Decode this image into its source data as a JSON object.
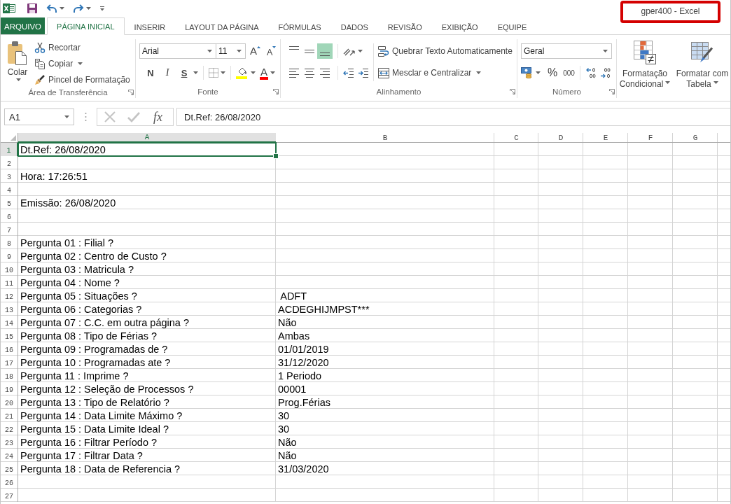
{
  "title": "gper400 - Excel",
  "title_highlight": true,
  "tabs": [
    {
      "label": "ARQUIVO",
      "kind": "file",
      "selected": false
    },
    {
      "label": "PÁGINA INICIAL",
      "kind": "tab",
      "selected": true
    },
    {
      "label": "INSERIR",
      "kind": "tab",
      "selected": false
    },
    {
      "label": "LAYOUT DA PÁGINA",
      "kind": "tab",
      "selected": false
    },
    {
      "label": "FÓRMULAS",
      "kind": "tab",
      "selected": false
    },
    {
      "label": "DADOS",
      "kind": "tab",
      "selected": false
    },
    {
      "label": "REVISÃO",
      "kind": "tab",
      "selected": false
    },
    {
      "label": "EXIBIÇÃO",
      "kind": "tab",
      "selected": false
    },
    {
      "label": "EQUIPE",
      "kind": "tab",
      "selected": false
    }
  ],
  "ribbon": {
    "clipboard": {
      "label": "Área de Transferência",
      "paste": "Colar",
      "items": [
        {
          "kind": "cut",
          "label": "Recortar",
          "dropdown": false
        },
        {
          "kind": "copy",
          "label": "Copiar",
          "dropdown": true
        },
        {
          "kind": "painter",
          "label": "Pincel de Formatação",
          "dropdown": false
        }
      ]
    },
    "font": {
      "label": "Fonte",
      "font_name": "Arial",
      "font_size": "11",
      "size_buttons": [
        {
          "kind": "grow",
          "label": "A"
        },
        {
          "kind": "shrink",
          "label": "A"
        }
      ],
      "styles": [
        {
          "kind": "bold",
          "label": "N",
          "dropdown": false
        },
        {
          "kind": "italic",
          "label": "I",
          "dropdown": false
        },
        {
          "kind": "underline",
          "label": "S",
          "dropdown": true
        }
      ],
      "font_color_label": "A"
    },
    "alignment": {
      "label": "Alinhamento",
      "vertical": [
        {
          "kind": "top",
          "selected": false
        },
        {
          "kind": "middle",
          "selected": false
        },
        {
          "kind": "bottom",
          "selected": true
        }
      ],
      "horizontal": [
        {
          "kind": "left",
          "selected": false
        },
        {
          "kind": "center",
          "selected": false
        },
        {
          "kind": "right",
          "selected": false
        }
      ],
      "wrap_text": "Quebrar Texto Automaticamente",
      "merge": "Mesclar e Centralizar"
    },
    "number": {
      "label": "Número",
      "format": "Geral",
      "percent": "%",
      "thousands": "000"
    },
    "styles": {
      "buttons": [
        {
          "kind": "conditional",
          "lines": [
            "Formatação",
            "Condicional"
          ]
        },
        {
          "kind": "table",
          "lines": [
            "Formatar com",
            "Tabela"
          ]
        }
      ]
    }
  },
  "formula_bar": {
    "name_box": "A1",
    "buttons": [
      {
        "kind": "cancel",
        "disabled": true
      },
      {
        "kind": "enter",
        "disabled": true
      }
    ],
    "function_label": "fx",
    "formula": "Dt.Ref: 26/08/2020"
  },
  "sheet": {
    "columns": [
      {
        "label": "A",
        "selected": true
      },
      {
        "label": "B",
        "selected": false
      },
      {
        "label": "C",
        "selected": false
      },
      {
        "label": "D",
        "selected": false
      },
      {
        "label": "E",
        "selected": false
      },
      {
        "label": "F",
        "selected": false
      },
      {
        "label": "G",
        "selected": false
      }
    ],
    "rows": [
      {
        "number": "1",
        "selected": true,
        "cells": [
          "Dt.Ref: 26/08/2020"
        ]
      },
      {
        "number": "2",
        "selected": false
      },
      {
        "number": "3",
        "selected": false,
        "cells": [
          "Hora: 17:26:51"
        ]
      },
      {
        "number": "4",
        "selected": false
      },
      {
        "number": "5",
        "selected": false,
        "cells": [
          "Emissão: 26/08/2020"
        ]
      },
      {
        "number": "6",
        "selected": false
      },
      {
        "number": "7",
        "selected": false
      },
      {
        "number": "8",
        "selected": false,
        "cells": [
          "Pergunta 01 : Filial ?"
        ]
      },
      {
        "number": "9",
        "selected": false,
        "cells": [
          "Pergunta 02 : Centro de Custo ?"
        ]
      },
      {
        "number": "10",
        "selected": false,
        "cells": [
          "Pergunta 03 : Matricula ?"
        ]
      },
      {
        "number": "11",
        "selected": false,
        "cells": [
          "Pergunta 04 : Nome ?"
        ]
      },
      {
        "number": "12",
        "selected": false,
        "cells": [
          "Pergunta 05 : Situações ?",
          " ADFT"
        ]
      },
      {
        "number": "13",
        "selected": false,
        "cells": [
          "Pergunta 06 : Categorias ?",
          "ACDEGHIJMPST***"
        ]
      },
      {
        "number": "14",
        "selected": false,
        "cells": [
          "Pergunta 07 : C.C. em outra página ?",
          "Não"
        ]
      },
      {
        "number": "15",
        "selected": false,
        "cells": [
          "Pergunta 08 : Tipo de Férias ?",
          "Ambas"
        ]
      },
      {
        "number": "16",
        "selected": false,
        "cells": [
          "Pergunta 09 : Programadas de ?",
          "01/01/2019"
        ]
      },
      {
        "number": "17",
        "selected": false,
        "cells": [
          "Pergunta 10 : Programadas ate ?",
          "31/12/2020"
        ]
      },
      {
        "number": "18",
        "selected": false,
        "cells": [
          "Pergunta 11 : Imprime ?",
          "1 Periodo"
        ]
      },
      {
        "number": "19",
        "selected": false,
        "cells": [
          "Pergunta 12 : Seleção de Processos ?",
          "00001"
        ]
      },
      {
        "number": "20",
        "selected": false,
        "cells": [
          "Pergunta 13 : Tipo de Relatório ?",
          "Prog.Férias"
        ]
      },
      {
        "number": "21",
        "selected": false,
        "cells": [
          "Pergunta 14 : Data Limite Máximo ?",
          "30"
        ]
      },
      {
        "number": "22",
        "selected": false,
        "cells": [
          "Pergunta 15 : Data Limite Ideal ?",
          "30"
        ]
      },
      {
        "number": "23",
        "selected": false,
        "cells": [
          "Pergunta 16 : Filtrar Período ?",
          "Não"
        ]
      },
      {
        "number": "24",
        "selected": false,
        "cells": [
          "Pergunta 17 : Filtrar Data ?",
          "Não"
        ]
      },
      {
        "number": "25",
        "selected": false,
        "cells": [
          "Pergunta 18 : Data de Referencia ?",
          "31/03/2020"
        ]
      },
      {
        "number": "26",
        "selected": false
      },
      {
        "number": "27",
        "selected": false
      }
    ]
  }
}
